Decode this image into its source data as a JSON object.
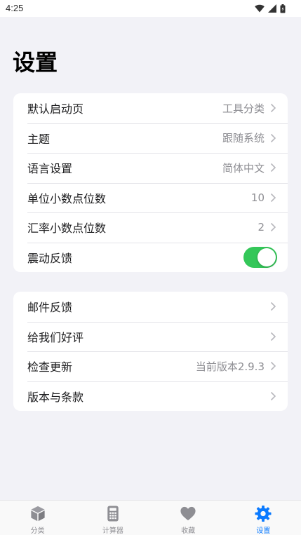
{
  "status_bar": {
    "time": "4:25"
  },
  "page_title": "设置",
  "group1": [
    {
      "label": "默认启动页",
      "value": "工具分类"
    },
    {
      "label": "主题",
      "value": "跟随系统"
    },
    {
      "label": "语言设置",
      "value": "简体中文"
    },
    {
      "label": "单位小数点位数",
      "value": "10"
    },
    {
      "label": "汇率小数点位数",
      "value": "2"
    },
    {
      "label": "震动反馈",
      "toggle_on": true
    }
  ],
  "group2": [
    {
      "label": "邮件反馈",
      "value": ""
    },
    {
      "label": "给我们好评",
      "value": ""
    },
    {
      "label": "检查更新",
      "value": "当前版本2.9.3"
    },
    {
      "label": "版本与条款",
      "value": ""
    }
  ],
  "tab_bar": [
    {
      "label": "分类",
      "icon": "cube-icon",
      "active": false
    },
    {
      "label": "计算器",
      "icon": "calculator-icon",
      "active": false
    },
    {
      "label": "收藏",
      "icon": "heart-icon",
      "active": false
    },
    {
      "label": "设置",
      "icon": "gear-icon",
      "active": true
    }
  ],
  "colors": {
    "accent": "#0a7aff",
    "toggle_on": "#34c759",
    "inactive_icon": "#8e8e93",
    "background": "#f2f2f7"
  }
}
